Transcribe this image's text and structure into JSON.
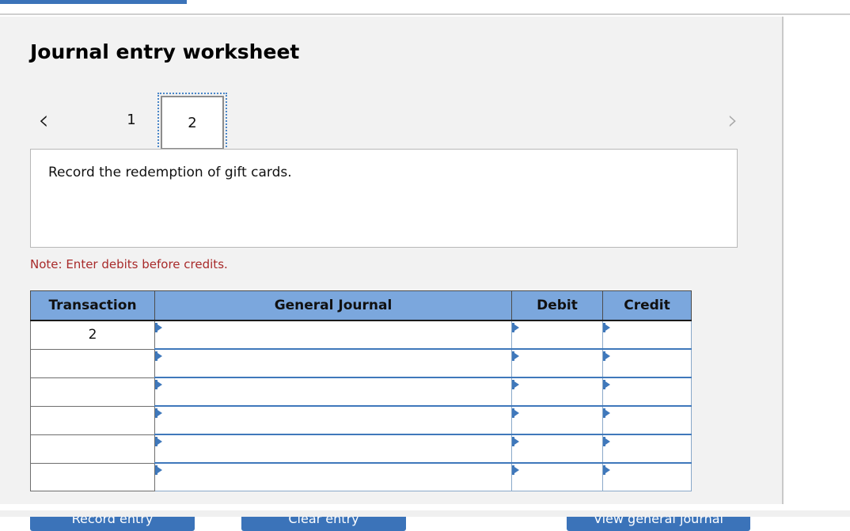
{
  "window": {
    "progress_bar_color": "#3b73b9",
    "panel_background": "#f2f2f2",
    "accent_color": "#3b73b9",
    "header_fill": "#7ba7dd",
    "note_color": "#a82a2a"
  },
  "header": {
    "title": "Journal entry worksheet"
  },
  "pager": {
    "prev_icon": "chevron-left-icon",
    "next_icon": "chevron-right-icon",
    "prev_glyph": "‹",
    "next_glyph": "›",
    "pages": [
      {
        "label": "1",
        "selected": false
      },
      {
        "label": "2",
        "selected": true
      }
    ]
  },
  "description": {
    "text": "Record the redemption of gift cards."
  },
  "note": {
    "text": "Note: Enter debits before credits."
  },
  "journal_table": {
    "columns": [
      "Transaction",
      "General Journal",
      "Debit",
      "Credit"
    ],
    "rows": [
      {
        "transaction": "2",
        "general_journal": "",
        "debit": "",
        "credit": ""
      },
      {
        "transaction": "",
        "general_journal": "",
        "debit": "",
        "credit": ""
      },
      {
        "transaction": "",
        "general_journal": "",
        "debit": "",
        "credit": ""
      },
      {
        "transaction": "",
        "general_journal": "",
        "debit": "",
        "credit": ""
      },
      {
        "transaction": "",
        "general_journal": "",
        "debit": "",
        "credit": ""
      },
      {
        "transaction": "",
        "general_journal": "",
        "debit": "",
        "credit": ""
      }
    ]
  },
  "footer": {
    "record_label": "Record entry",
    "clear_label": "Clear entry",
    "view_label": "View general journal"
  }
}
